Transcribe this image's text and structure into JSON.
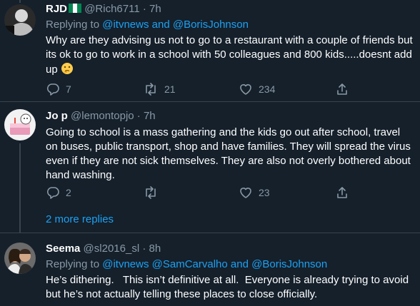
{
  "tweets": [
    {
      "display_name": "RJD",
      "handle": "@Rich6711",
      "dot": "·",
      "time": "7h",
      "replying_prefix": "Replying to ",
      "replying_a": "@itvnews",
      "replying_and": " and ",
      "replying_b": "@BorisJohnson",
      "text": "Why are they advising us not to go to a restaurant with a couple of friends but its ok to go to work in a school with 50 colleagues and 800 kids.....doesnt add up",
      "replies": "7",
      "retweets": "21",
      "likes": "234"
    },
    {
      "display_name": "Jo p",
      "handle": "@lemontopjo",
      "dot": "·",
      "time": "7h",
      "text": "Going to school is a mass gathering and the kids go out after school, travel on buses, public transport, shop and have families. They will spread the virus even if they are not sick themselves. They are also not overly bothered about hand washing.",
      "replies": "2",
      "retweets": "",
      "likes": "23"
    },
    {
      "display_name": "Seema",
      "handle": "@sl2016_sl",
      "dot": "·",
      "time": "8h",
      "replying_prefix": "Replying to ",
      "replying_a": "@itvnews",
      "replying_sep": " ",
      "replying_b": "@SamCarvalho",
      "replying_and": " and ",
      "replying_c": "@BorisJohnson",
      "text": "He’s dithering.   This isn’t definitive at all.  Everyone is already trying to avoid but he’s not actually telling these places to close officially."
    }
  ],
  "more_replies": "2 more replies",
  "icons": {
    "reply": "reply-icon",
    "retweet": "retweet-icon",
    "like": "heart-icon",
    "share": "share-icon",
    "flag": "nigeria-flag-icon",
    "emoji": "thinking-face-icon"
  },
  "colors": {
    "background": "#15202b",
    "muted": "#8899a6",
    "link": "#1da1f2",
    "divider": "#38444d"
  }
}
